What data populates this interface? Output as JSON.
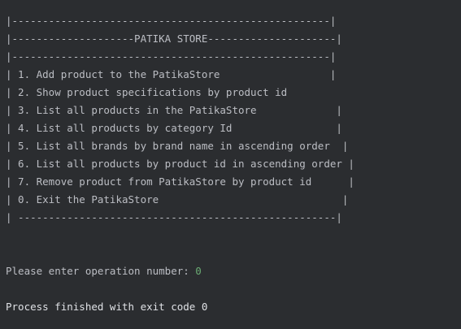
{
  "console": {
    "menu_lines": [
      "|----------------------------------------------------|",
      "|--------------------PATIKA STORE---------------------|",
      "|----------------------------------------------------|",
      "| 1. Add product to the PatikaStore                  |",
      "| 2. Show product specifications by product id",
      "| 3. List all products in the PatikaStore             |",
      "| 4. List all products by category Id                 |",
      "| 5. List all brands by brand name in ascending order  |",
      "| 6. List all products by product id in ascending order |",
      "| 7. Remove product from PatikaStore by product id      |",
      "| 0. Exit the PatikaStore                              |",
      "| ----------------------------------------------------|"
    ],
    "prompt_label": "Please enter operation number: ",
    "prompt_value": "0",
    "exit_message": "Process finished with exit code 0"
  },
  "colors": {
    "background": "#2b2d30",
    "text": "#bcbec4",
    "input": "#6aab73"
  }
}
